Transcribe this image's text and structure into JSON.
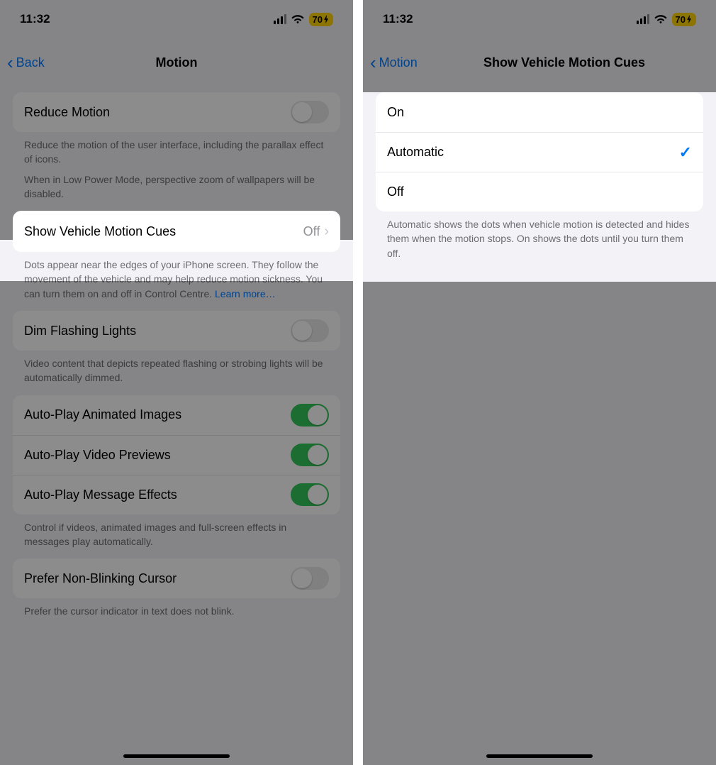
{
  "status": {
    "time": "11:32",
    "battery": "70"
  },
  "left": {
    "back": "Back",
    "title": "Motion",
    "reduce_motion": {
      "label": "Reduce Motion",
      "on": false
    },
    "reduce_motion_footer": "Reduce the motion of the user interface, including the parallax effect of icons.",
    "low_power_footer": "When in Low Power Mode, perspective zoom of wallpapers will be disabled.",
    "vehicle_cues": {
      "label": "Show Vehicle Motion Cues",
      "value": "Off"
    },
    "vehicle_cues_footer": "Dots appear near the edges of your iPhone screen. They follow the movement of the vehicle and may help reduce motion sickness. You can turn them on and off in Control Centre. ",
    "vehicle_cues_learn_more": "Learn more…",
    "dim_flashing": {
      "label": "Dim Flashing Lights",
      "on": false
    },
    "dim_flashing_footer": "Video content that depicts repeated flashing or strobing lights will be automatically dimmed.",
    "autoplay_images": {
      "label": "Auto-Play Animated Images",
      "on": true
    },
    "autoplay_video": {
      "label": "Auto-Play Video Previews",
      "on": true
    },
    "autoplay_effects": {
      "label": "Auto-Play Message Effects",
      "on": true
    },
    "autoplay_footer": "Control if videos, animated images and full-screen effects in messages play automatically.",
    "non_blinking": {
      "label": "Prefer Non-Blinking Cursor",
      "on": false
    },
    "non_blinking_footer": "Prefer the cursor indicator in text does not blink."
  },
  "right": {
    "back": "Motion",
    "title": "Show Vehicle Motion Cues",
    "options": {
      "on": "On",
      "automatic": "Automatic",
      "off": "Off",
      "selected": "automatic"
    },
    "footer": "Automatic shows the dots when vehicle motion is detected and hides them when the motion stops. On shows the dots until you turn them off."
  }
}
